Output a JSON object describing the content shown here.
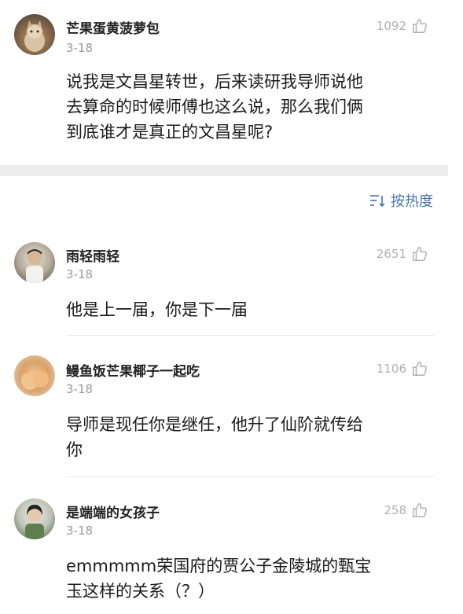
{
  "post": {
    "author": "芒果蛋黄菠萝包",
    "date": "3-18",
    "likes": "1092",
    "text_lines": [
      "说我是文昌星转世，后来读研我导师说他",
      "去算命的时候师傅也这么说，那么我们俩",
      "到底谁才是真正的文昌星呢?"
    ]
  },
  "sort": {
    "label": "按热度"
  },
  "comments": [
    {
      "author": "雨轻雨轻",
      "date": "3-18",
      "likes": "2651",
      "text_lines": [
        "他是上一届，你是下一届"
      ]
    },
    {
      "author": "鳗鱼饭芒果椰子一起吃",
      "date": "3-18",
      "likes": "1106",
      "text_lines": [
        "导师是现任你是继任，他升了仙阶就传给",
        "你"
      ]
    },
    {
      "author": "是端端的女孩子",
      "date": "3-18",
      "likes": "258",
      "text_lines": [
        "emmmmm荣国府的贾公子金陵城的甄宝",
        "玉这样的关系（？）"
      ]
    }
  ]
}
